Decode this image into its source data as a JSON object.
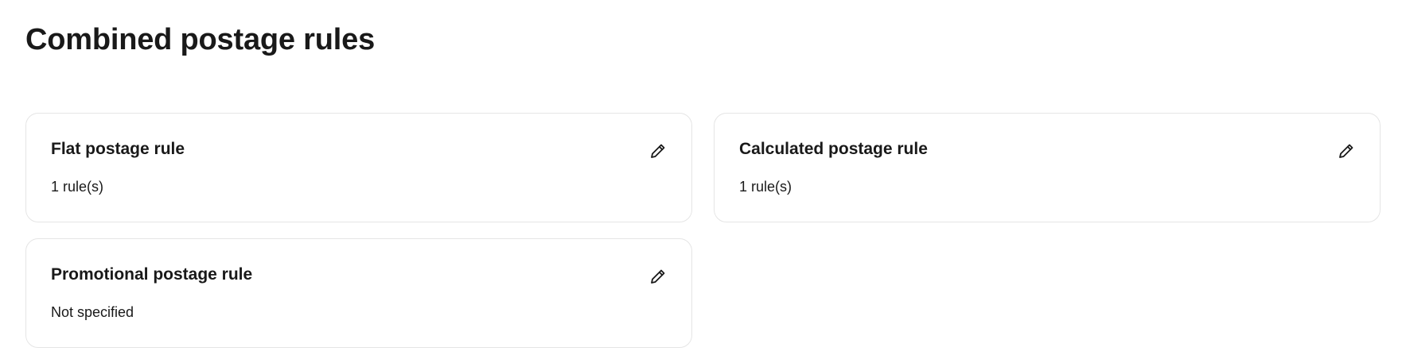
{
  "page": {
    "title": "Combined postage rules"
  },
  "cards": [
    {
      "title": "Flat postage rule",
      "value": "1 rule(s)",
      "icon": "pencil-icon"
    },
    {
      "title": "Calculated postage rule",
      "value": "1 rule(s)",
      "icon": "pencil-icon"
    },
    {
      "title": "Promotional postage rule",
      "value": "Not specified",
      "icon": "pencil-icon"
    }
  ],
  "colors": {
    "text": "#191919",
    "card_border": "#e5e5e5",
    "background": "#ffffff"
  }
}
